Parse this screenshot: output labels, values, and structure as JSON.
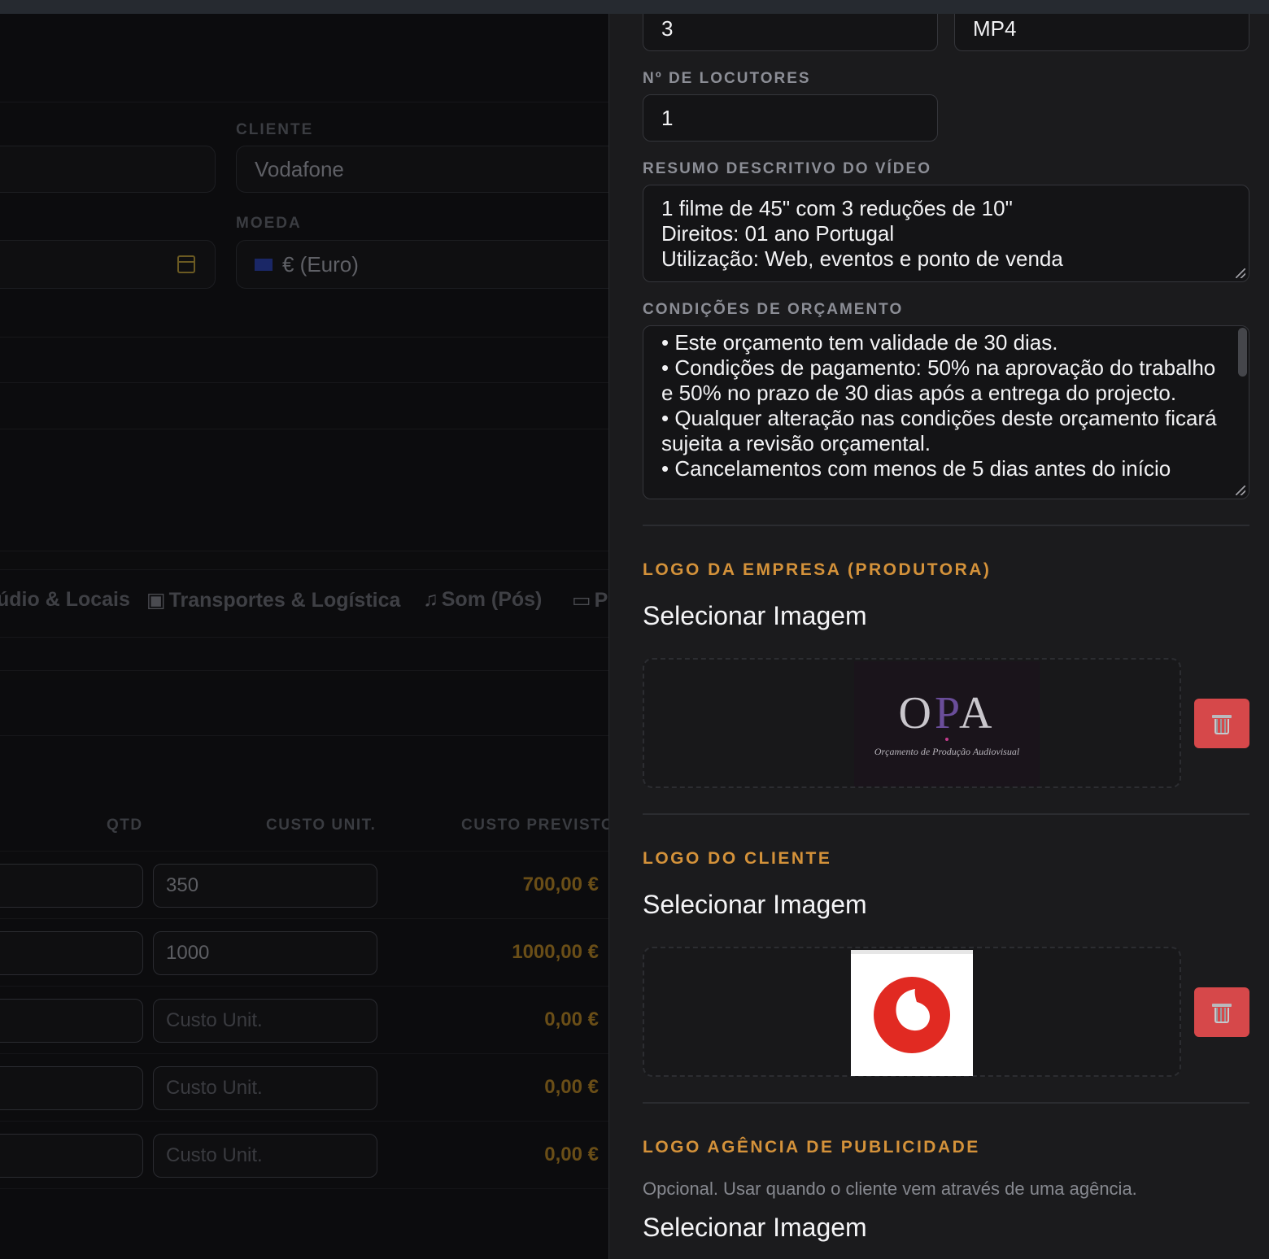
{
  "background": {
    "client_label": "CLIENTE",
    "client_value": "Vodafone",
    "currency_label": "MOEDA",
    "currency_value": "€ (Euro)",
    "tabs": [
      {
        "label": "údio & Locais"
      },
      {
        "icon": "truck-icon",
        "label": "Transportes & Logística"
      },
      {
        "icon": "music-note-icon",
        "label": "Som (Pós)"
      },
      {
        "icon": "monitor-icon",
        "label": "P"
      }
    ],
    "columns": {
      "qty": "QTD",
      "unit_cost": "CUSTO UNIT.",
      "planned_cost": "CUSTO PREVISTO"
    },
    "rows": [
      {
        "unit_cost": "350",
        "total": "700,00 €"
      },
      {
        "unit_cost": "1000",
        "total": "1000,00 €"
      },
      {
        "unit_cost": "",
        "placeholder": "Custo Unit.",
        "total": "0,00 €"
      },
      {
        "unit_cost": "",
        "placeholder": "Custo Unit.",
        "total": "0,00 €"
      },
      {
        "unit_cost": "",
        "placeholder": "Custo Unit.",
        "total": "0,00 €"
      }
    ]
  },
  "panel": {
    "top_left_value": "3",
    "top_right_value": "MP4",
    "speakers_label": "Nº DE LOCUTORES",
    "speakers_value": "1",
    "summary_label": "RESUMO DESCRITIVO DO VÍDEO",
    "summary_value": "1 filme de 45\" com 3 reduções de 10\"\nDireitos: 01 ano Portugal\nUtilização: Web, eventos e ponto de venda",
    "conditions_label": "CONDIÇÕES DE ORÇAMENTO",
    "conditions_value": "• Este orçamento tem validade de 30 dias.\n• Condições de pagamento: 50% na aprovação do trabalho e 50% no prazo de 30 dias após a entrega do projecto.\n• Qualquer alteração nas condições deste orçamento ficará sujeita a revisão orçamental.\n• Cancelamentos com menos de 5 dias antes do início",
    "company_logo_title": "LOGO DA EMPRESA (PRODUTORA)",
    "client_logo_title": "LOGO DO CLIENTE",
    "agency_logo_title": "LOGO AGÊNCIA DE PUBLICIDADE",
    "agency_hint": "Opcional. Usar quando o cliente vem através de uma agência.",
    "select_image_label": "Selecionar Imagem",
    "opa_logo": {
      "letters_left": "O",
      "letters_mid": "P",
      "letters_right": "A",
      "subtitle": "Orçamento de Produção Audiovisual"
    },
    "delete_icon": "trash-icon"
  },
  "colors": {
    "accent": "#d4923a",
    "danger": "#d6484a",
    "vodafone_red": "#e12a22"
  }
}
